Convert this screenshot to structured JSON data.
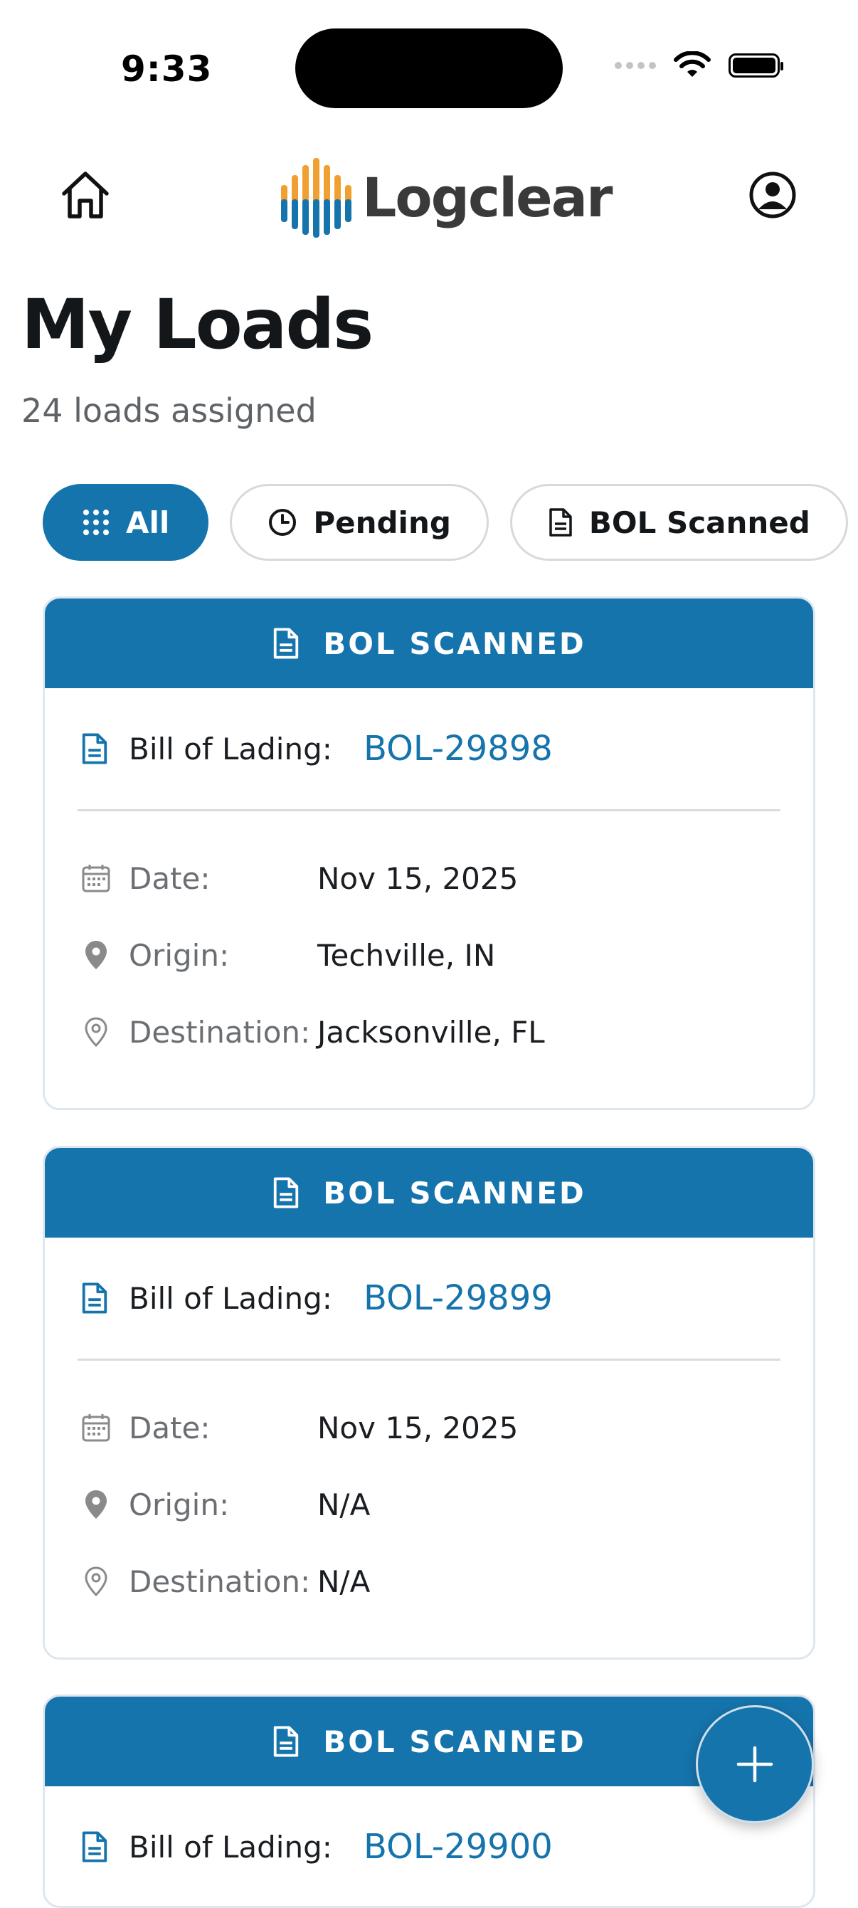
{
  "status_bar": {
    "time": "9:33"
  },
  "header": {
    "brand": "Logclear"
  },
  "page": {
    "title": "My Loads",
    "subtitle": "24 loads assigned"
  },
  "filters": [
    {
      "label": "All",
      "icon": "grid-icon",
      "active": true
    },
    {
      "label": "Pending",
      "icon": "clock-icon",
      "active": false
    },
    {
      "label": "BOL Scanned",
      "icon": "document-icon",
      "active": false
    }
  ],
  "cards": [
    {
      "status": "BOL SCANNED",
      "bol_label": "Bill of Lading:",
      "bol": "BOL-29898",
      "date_label": "Date:",
      "date": "Nov 15, 2025",
      "origin_label": "Origin:",
      "origin": "Techville, IN",
      "destination_label": "Destination:",
      "destination": "Jacksonville, FL"
    },
    {
      "status": "BOL SCANNED",
      "bol_label": "Bill of Lading:",
      "bol": "BOL-29899",
      "date_label": "Date:",
      "date": "Nov 15, 2025",
      "origin_label": "Origin:",
      "origin": "N/A",
      "destination_label": "Destination:",
      "destination": "N/A"
    },
    {
      "status": "BOL SCANNED",
      "bol_label": "Bill of Lading:",
      "bol": "BOL-29900"
    }
  ],
  "colors": {
    "accent": "#1674ad",
    "logo_orange": "#f0a030"
  }
}
